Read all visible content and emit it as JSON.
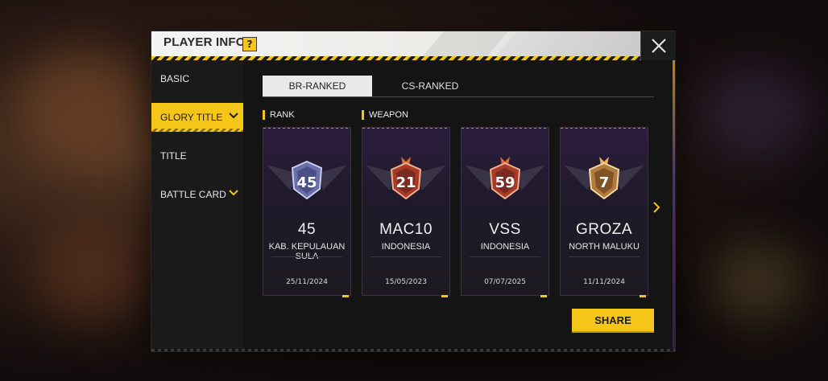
{
  "header": {
    "title": "PLAYER INFO",
    "help_badge": "?"
  },
  "sidebar": {
    "items": [
      {
        "label": "BASIC",
        "active": false,
        "has_chevron": false
      },
      {
        "label": "GLORY TITLE",
        "active": true,
        "has_chevron": true
      },
      {
        "label": "TITLE",
        "active": false,
        "has_chevron": false
      },
      {
        "label": "BATTLE CARD",
        "active": false,
        "has_chevron": true
      }
    ]
  },
  "tabs": [
    {
      "label": "BR-RANKED",
      "active": true
    },
    {
      "label": "CS-RANKED",
      "active": false
    }
  ],
  "sections": {
    "rank": "RANK",
    "weapon": "WEAPON"
  },
  "cards": [
    {
      "badge": "45",
      "name": "45",
      "region": "KAB. KEPULAUAN SULA",
      "date": "25/11/2024",
      "type": "rank"
    },
    {
      "badge": "21",
      "name": "MAC10",
      "region": "INDONESIA",
      "date": "15/05/2023",
      "type": "weapon"
    },
    {
      "badge": "59",
      "name": "VSS",
      "region": "INDONESIA",
      "date": "07/07/2025",
      "type": "weapon"
    },
    {
      "badge": "7",
      "name": "GROZA",
      "region": "NORTH MALUKU",
      "date": "11/11/2024",
      "type": "weapon"
    }
  ],
  "actions": {
    "share_label": "SHARE"
  },
  "icons": {
    "close": "close-icon",
    "next": "chevron-right-icon",
    "dropdown": "chevron-down-icon"
  },
  "colors": {
    "accent": "#f5c518",
    "panel": "#151415",
    "card_top": "#2b1d3d"
  }
}
